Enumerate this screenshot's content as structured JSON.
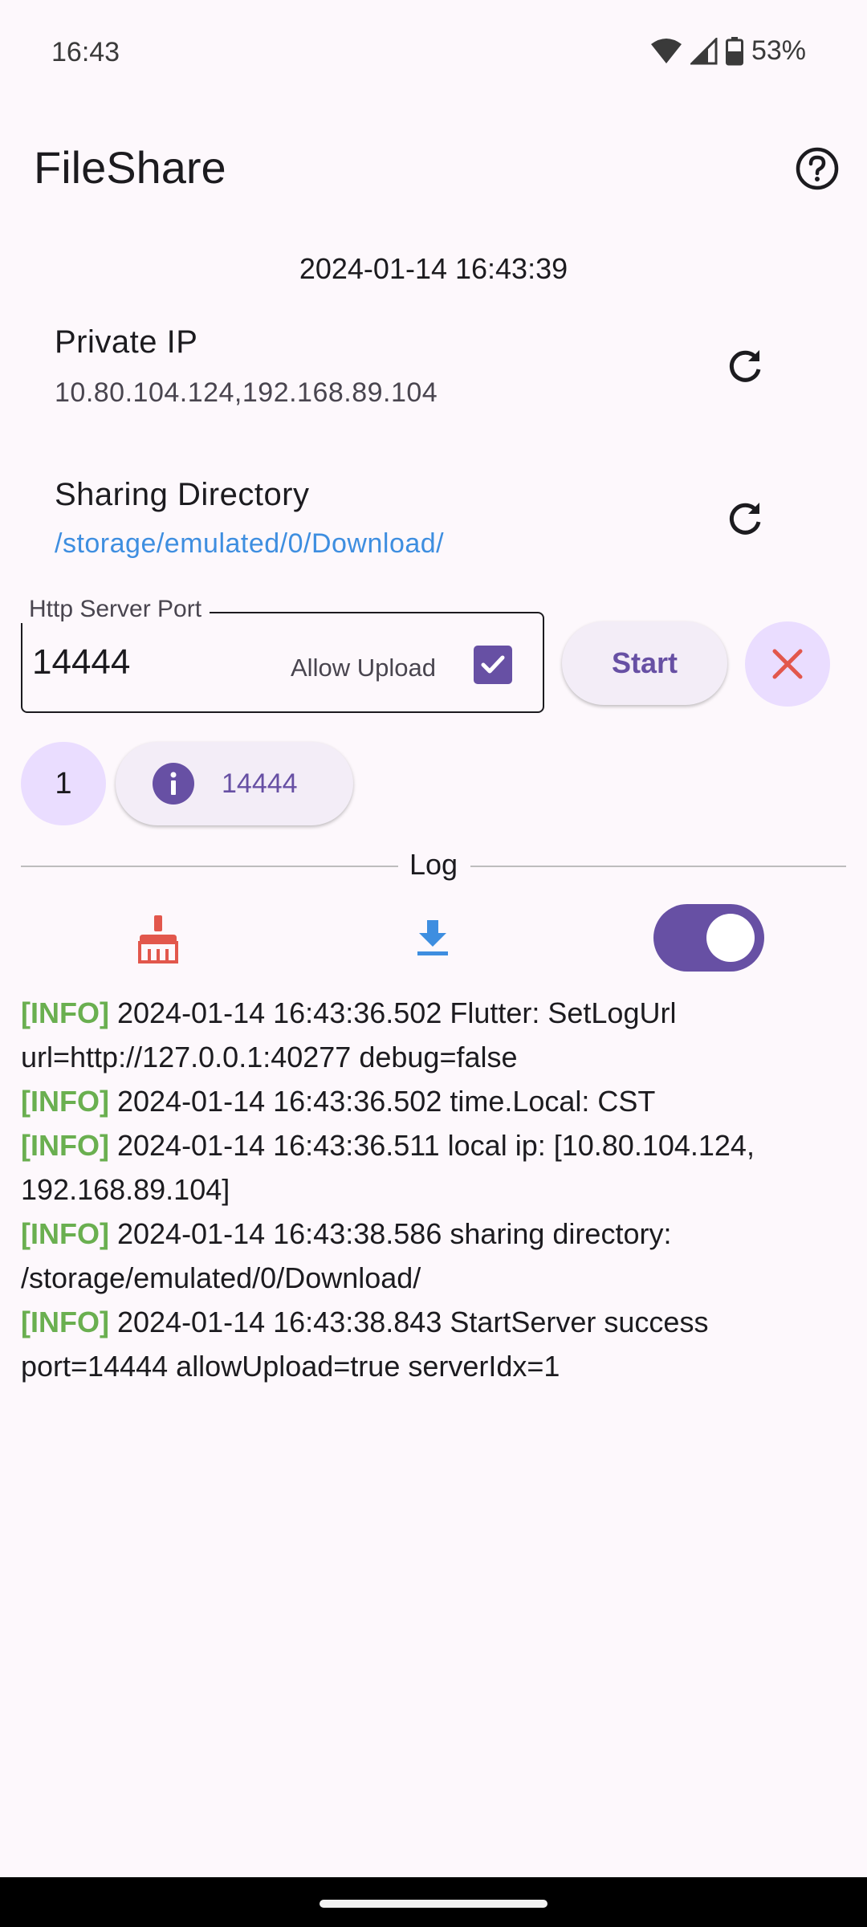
{
  "status_bar": {
    "time": "16:43",
    "battery": "53%"
  },
  "app_bar": {
    "title": "FileShare",
    "help_icon": "help-circle-icon"
  },
  "datetime": "2024-01-14 16:43:39",
  "private_ip": {
    "title": "Private IP",
    "value": "10.80.104.124,192.168.89.104"
  },
  "sharing_directory": {
    "title": "Sharing Directory",
    "value": "/storage/emulated/0/Download/"
  },
  "server": {
    "port_label": "Http Server Port",
    "port_value": "14444",
    "allow_upload_label": "Allow Upload",
    "allow_upload_checked": true,
    "start_label": "Start"
  },
  "servers": {
    "count": "1",
    "chip_label": "14444"
  },
  "log": {
    "label": "Log",
    "toggle_on": true,
    "tag": "[INFO]",
    "entries": [
      "2024-01-14 16:43:36.502 Flutter: SetLogUrl url=http://127.0.0.1:40277 debug=false",
      "2024-01-14 16:43:36.502 time.Local: CST",
      "2024-01-14 16:43:36.511 local ip: [10.80.104.124, 192.168.89.104]",
      "2024-01-14 16:43:38.586 sharing directory: /storage/emulated/0/Download/",
      "2024-01-14 16:43:38.843 StartServer success port=14444 allowUpload=true serverIdx=1"
    ]
  },
  "colors": {
    "primary": "#6750A4",
    "link": "#3E8EE0",
    "info_tag": "#6AAF50",
    "clear_icon": "#E2574C",
    "download_icon": "#3E8EE0",
    "stop_icon": "#E2574C"
  }
}
